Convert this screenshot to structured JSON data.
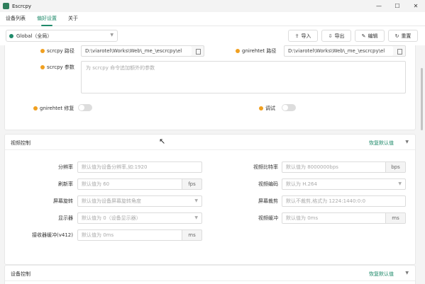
{
  "window": {
    "title": "Escrcpy",
    "controls": [
      "—",
      "☐",
      "✕"
    ]
  },
  "tabs": [
    {
      "label": "设备列表",
      "active": false
    },
    {
      "label": "偏好设置",
      "active": true
    },
    {
      "label": "关于",
      "active": false
    }
  ],
  "toolbar": {
    "preset": "Global（全局）",
    "import_label": "导入",
    "export_label": "导出",
    "edit_label": "编辑",
    "reset_label": "重置"
  },
  "paths": {
    "scrcpy_label": "scrcpy 路径",
    "scrcpy_value": "D:\\viarotel\\Works\\Web\\_me_\\escrcpy\\el",
    "gnirehtet_label": "gnirehtet 路径",
    "gnirehtet_value": "D:\\viarotel\\Works\\Web\\_me_\\escrcpy\\el",
    "args_label": "scrcpy 参数",
    "args_placeholder": "为 scrcpy 命令追加额外的参数",
    "fix_label": "gnirehtet 修复",
    "debug_label": "调试"
  },
  "video": {
    "title": "视频控制",
    "reset_label": "恢复默认值",
    "fields": {
      "resolution_label": "分辨率",
      "resolution_placeholder": "默认值为设备分辨率,如:1920",
      "bitrate_label": "视频比特率",
      "bitrate_placeholder": "默认值为 8000000bps",
      "bitrate_unit": "bps",
      "fps_label": "刷新率",
      "fps_placeholder": "默认值为 60",
      "fps_unit": "fps",
      "codec_label": "视频编码",
      "codec_placeholder": "默认为 H.264",
      "rotation_label": "屏幕旋转",
      "rotation_placeholder": "默认值为设备屏幕旋转角度",
      "crop_label": "屏幕裁剪",
      "crop_placeholder": "默认不裁剪,格式为 1224:1440:0:0",
      "display_label": "显示器",
      "display_placeholder": "默认值为 0（设备显示器）",
      "buffer_label": "视频缓冲",
      "buffer_placeholder": "默认值为 0ms",
      "buffer_unit": "ms",
      "v4l2_label": "接收器缓冲(v412)",
      "v4l2_placeholder": "默认值为 0ms",
      "v4l2_unit": "ms"
    }
  },
  "device": {
    "title": "设备控制",
    "reset_label": "恢复默认值"
  },
  "icons": {
    "accent": "#1f8a6a",
    "help_color": "#f0a020"
  }
}
